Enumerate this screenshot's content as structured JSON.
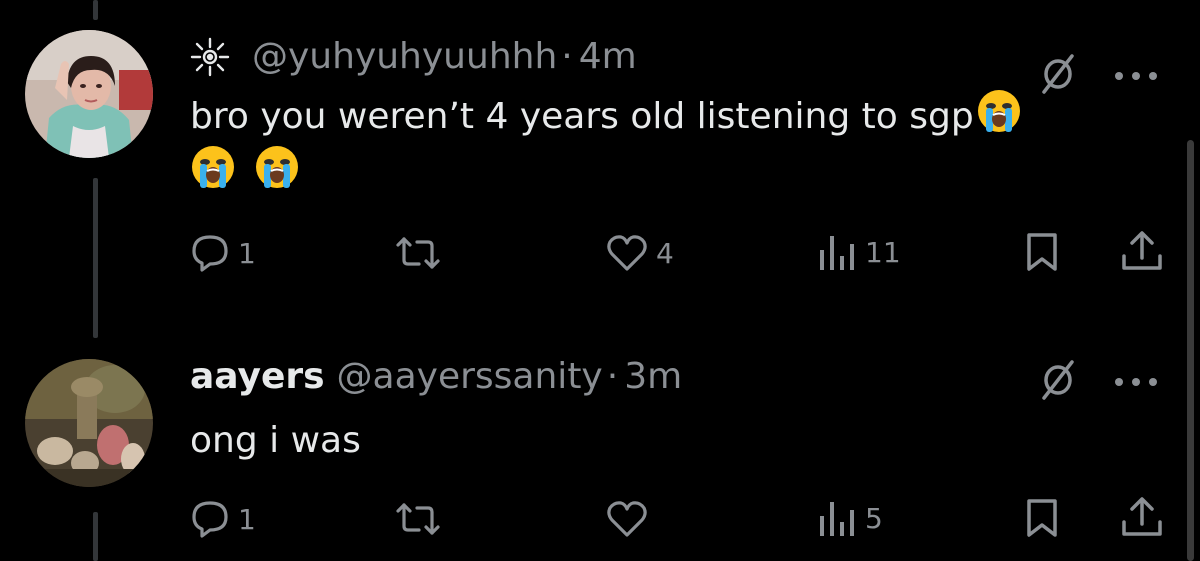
{
  "tweets": [
    {
      "display_name": "",
      "handle": "@yuhyuhyuuhhh",
      "separator": "·",
      "time": "4m",
      "text": "bro you weren’t 4 years old listening to sgp",
      "actions": {
        "reply_count": "1",
        "retweet_count": "",
        "like_count": "4",
        "view_count": "11"
      },
      "icons": [
        "sparkle-badge-icon",
        "crying-face-emoji",
        "mute-icon",
        "more-options-icon",
        "reply-icon",
        "retweet-icon",
        "like-icon",
        "views-icon",
        "bookmark-icon",
        "share-icon"
      ]
    },
    {
      "display_name": "aayers",
      "handle": "@aayerssanity",
      "separator": "·",
      "time": "3m",
      "text": "ong i was",
      "actions": {
        "reply_count": "1",
        "retweet_count": "",
        "like_count": "",
        "view_count": "5"
      },
      "icons": [
        "mute-icon",
        "more-options-icon",
        "reply-icon",
        "retweet-icon",
        "like-icon",
        "views-icon",
        "bookmark-icon",
        "share-icon"
      ]
    }
  ],
  "colors": {
    "background": "#000000",
    "primary_text": "#e7e9ea",
    "secondary_text": "#8b8f94",
    "thread_line": "#333639"
  }
}
